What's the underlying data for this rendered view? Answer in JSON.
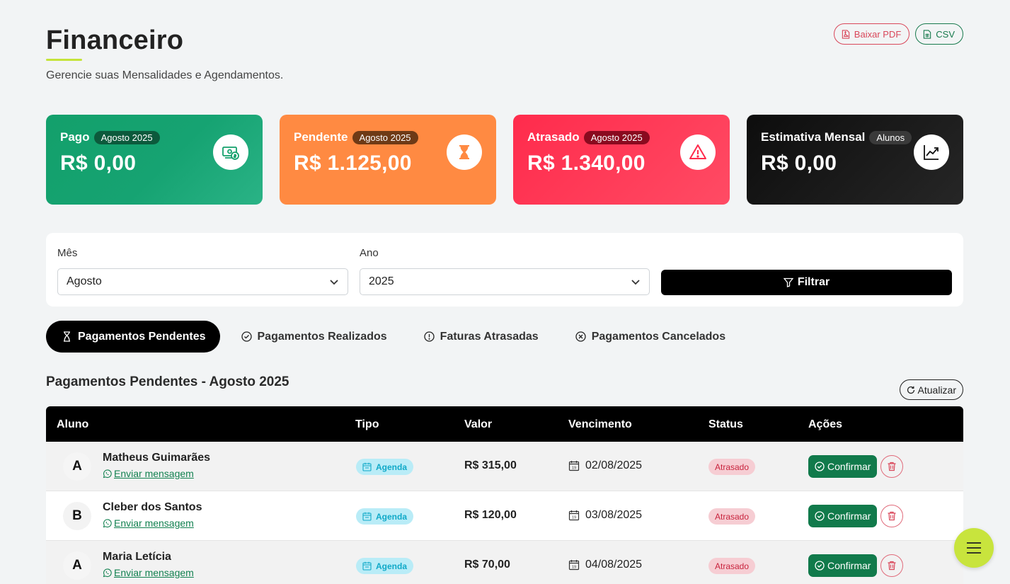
{
  "header": {
    "title": "Financeiro",
    "subtitle": "Gerencie suas Mensalidades e Agendamentos."
  },
  "export": {
    "pdf_label": "Baixar PDF",
    "csv_label": "CSV"
  },
  "cards": [
    {
      "label": "Pago",
      "badge": "Agosto 2025",
      "value": "R$ 0,00",
      "icon": "money-icon",
      "color": "#13a06b"
    },
    {
      "label": "Pendente",
      "badge": "Agosto 2025",
      "value": "R$ 1.125,00",
      "icon": "hourglass-icon",
      "color": "#ff8a42"
    },
    {
      "label": "Atrasado",
      "badge": "Agosto 2025",
      "value": "R$ 1.340,00",
      "icon": "warning-icon",
      "color": "#ff2b4c"
    },
    {
      "label": "Estimativa Mensal",
      "badge": "Alunos",
      "value": "R$ 0,00",
      "icon": "trend-up-icon",
      "color": "#111111"
    }
  ],
  "filters": {
    "month_label": "Mês",
    "month_value": "Agosto",
    "year_label": "Ano",
    "year_value": "2025",
    "filter_button": "Filtrar"
  },
  "tabs": [
    {
      "label": "Pagamentos Pendentes",
      "icon": "hourglass-icon",
      "active": true
    },
    {
      "label": "Pagamentos Realizados",
      "icon": "check-circle-icon",
      "active": false
    },
    {
      "label": "Faturas Atrasadas",
      "icon": "alert-circle-icon",
      "active": false
    },
    {
      "label": "Pagamentos Cancelados",
      "icon": "x-circle-icon",
      "active": false
    }
  ],
  "section": {
    "title": "Pagamentos Pendentes - Agosto 2025",
    "refresh_label": "Atualizar"
  },
  "table": {
    "columns": [
      "Aluno",
      "Tipo",
      "Valor",
      "Vencimento",
      "Status",
      "Ações"
    ],
    "message_label": "Enviar mensagem",
    "confirm_label": "Confirmar",
    "rows": [
      {
        "initial": "A",
        "name": "Matheus Guimarães",
        "tipo": "Agenda",
        "valor": "R$ 315,00",
        "vencimento": "02/08/2025",
        "status": "Atrasado"
      },
      {
        "initial": "B",
        "name": "Cleber dos Santos",
        "tipo": "Agenda",
        "valor": "R$ 120,00",
        "vencimento": "03/08/2025",
        "status": "Atrasado"
      },
      {
        "initial": "A",
        "name": "Maria Letícia",
        "tipo": "Agenda",
        "valor": "R$ 70,00",
        "vencimento": "04/08/2025",
        "status": "Atrasado"
      }
    ]
  },
  "colors": {
    "accent": "#c5e43a",
    "confirm": "#117a4b",
    "danger": "#d9475a"
  }
}
